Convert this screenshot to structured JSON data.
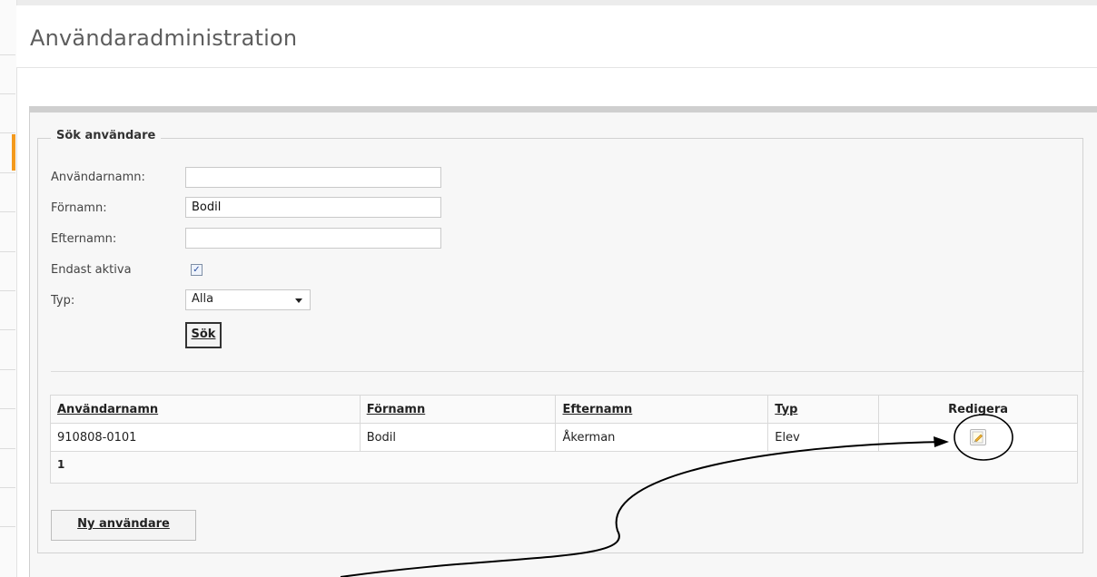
{
  "page": {
    "title": "Användaradministration"
  },
  "search": {
    "legend": "Sök användare",
    "username_label": "Användarnamn:",
    "username_value": "",
    "firstname_label": "Förnamn:",
    "firstname_value": "Bodil",
    "lastname_label": "Efternamn:",
    "lastname_value": "",
    "active_label": "Endast aktiva",
    "active_checked": true,
    "type_label": "Typ:",
    "type_value": "Alla",
    "search_button": "Sök"
  },
  "results": {
    "headers": {
      "username": "Användarnamn",
      "firstname": "Förnamn",
      "lastname": "Efternamn",
      "type": "Typ",
      "edit": "Redigera"
    },
    "rows": [
      {
        "username": "910808-0101",
        "firstname": "Bodil",
        "lastname": "Åkerman",
        "type": "Elev",
        "edit_icon": "pencil-icon"
      }
    ],
    "pager": "1"
  },
  "actions": {
    "new_user_button": "Ny användare"
  },
  "colors": {
    "accent": "#f39a1e",
    "panel_bg": "#f7f7f7"
  }
}
